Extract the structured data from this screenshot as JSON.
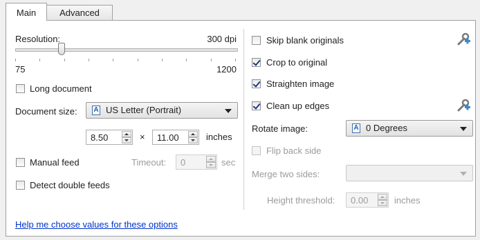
{
  "tabs": [
    {
      "label": "Main"
    },
    {
      "label": "Advanced"
    }
  ],
  "resolution": {
    "label": "Resolution:",
    "value_text": "300 dpi",
    "min_label": "75",
    "max_label": "1200",
    "value": 300,
    "min": 75,
    "max": 1200
  },
  "long_document": {
    "label": "Long document",
    "checked": false
  },
  "document_size": {
    "label": "Document size:",
    "selected": "US Letter (Portrait)"
  },
  "dimensions": {
    "width": "8.50",
    "times": "×",
    "height": "11.00",
    "unit": "inches"
  },
  "manual_feed": {
    "label": "Manual feed",
    "checked": false,
    "timeout_label": "Timeout:",
    "timeout_value": "0",
    "timeout_unit": "sec"
  },
  "detect_double_feeds": {
    "label": "Detect double feeds",
    "checked": false
  },
  "right": {
    "skip_blank": {
      "label": "Skip blank originals",
      "checked": false
    },
    "crop": {
      "label": "Crop to original",
      "checked": true
    },
    "straighten": {
      "label": "Straighten image",
      "checked": true
    },
    "clean_edges": {
      "label": "Clean up edges",
      "checked": true
    },
    "rotate": {
      "label": "Rotate image:",
      "selected": "0 Degrees"
    },
    "flip_back": {
      "label": "Flip back side",
      "checked": false
    },
    "merge": {
      "label": "Merge two sides:",
      "selected": ""
    },
    "height_threshold": {
      "label": "Height threshold:",
      "value": "0.00",
      "unit": "inches"
    }
  },
  "help_link": "Help me choose values for these options",
  "icons": {
    "settings": "wrench-plus-icon",
    "document": "document-icon"
  },
  "colors": {
    "link": "#0033cc",
    "check": "#1c3a82",
    "panel_bg": "#ffffff",
    "window_bg": "#f0f0f0"
  }
}
